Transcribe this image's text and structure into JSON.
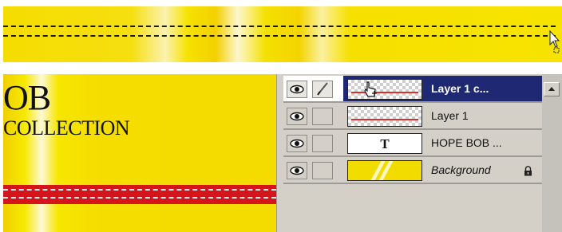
{
  "canvas": {
    "title": "OB",
    "subtitle": "COLLECTION"
  },
  "layers": [
    {
      "name": "Layer 1 c...",
      "thumbnail": "checker-redline",
      "selected": true,
      "visible": true,
      "brush": true
    },
    {
      "name": "Layer 1",
      "thumbnail": "checker-redline",
      "selected": false,
      "visible": true,
      "brush": false
    },
    {
      "name": "HOPE BOB ...",
      "thumbnail": "text-T",
      "thumbnail_text": "T",
      "selected": false,
      "visible": true,
      "brush": false
    },
    {
      "name": "Background",
      "thumbnail": "yellow-stripes",
      "selected": false,
      "visible": true,
      "brush": false,
      "locked": true
    }
  ],
  "icons": {
    "visibility": "eye-icon",
    "paintbrush": "paintbrush-icon",
    "lock": "lock-icon",
    "cursor": "arrow-cursor-icon",
    "hand": "hand-cursor-icon"
  },
  "colors": {
    "canvas_yellow": "#f5dc00",
    "red_band": "#d4151b",
    "selection_blue": "#1f2873",
    "panel_gray": "#d4d0c8"
  }
}
